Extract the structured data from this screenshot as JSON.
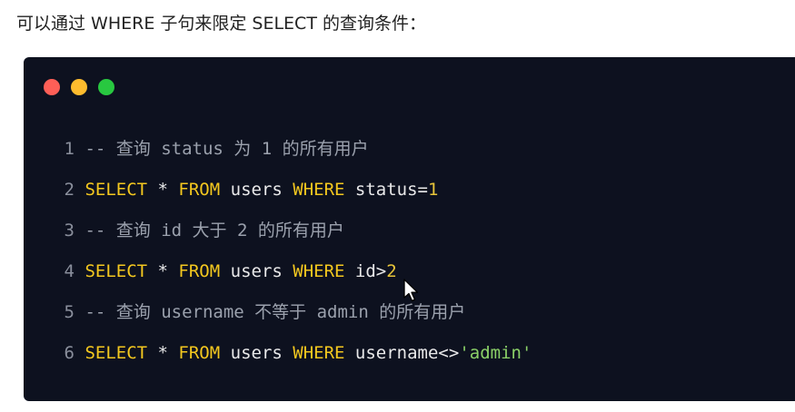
{
  "intro_text": "可以通过 WHERE 子句来限定 SELECT 的查询条件：",
  "window_controls": [
    {
      "name": "close",
      "color": "#fe5f57"
    },
    {
      "name": "minimize",
      "color": "#febc2e"
    },
    {
      "name": "maximize",
      "color": "#28c840"
    }
  ],
  "colors": {
    "card_background": "#0d111f",
    "keyword": "#f4c81f",
    "comment": "#9ba1ad",
    "identifier": "#e9e9ea",
    "number": "#e8c53a",
    "string": "#8bd168"
  },
  "code": {
    "lines": [
      {
        "number": "1",
        "tokens": [
          {
            "type": "comment",
            "text": "-- 查询 status 为 1 的所有用户"
          }
        ]
      },
      {
        "number": "2",
        "tokens": [
          {
            "type": "kw",
            "text": "SELECT"
          },
          {
            "type": "plain",
            "text": " * "
          },
          {
            "type": "kw",
            "text": "FROM"
          },
          {
            "type": "plain",
            "text": " users "
          },
          {
            "type": "kw",
            "text": "WHERE"
          },
          {
            "type": "plain",
            "text": " status="
          },
          {
            "type": "num",
            "text": "1"
          }
        ]
      },
      {
        "number": "3",
        "tokens": [
          {
            "type": "comment",
            "text": "-- 查询 id 大于 2 的所有用户"
          }
        ]
      },
      {
        "number": "4",
        "tokens": [
          {
            "type": "kw",
            "text": "SELECT"
          },
          {
            "type": "plain",
            "text": " * "
          },
          {
            "type": "kw",
            "text": "FROM"
          },
          {
            "type": "plain",
            "text": " users "
          },
          {
            "type": "kw",
            "text": "WHERE"
          },
          {
            "type": "plain",
            "text": " id>"
          },
          {
            "type": "num",
            "text": "2"
          }
        ]
      },
      {
        "number": "5",
        "tokens": [
          {
            "type": "comment",
            "text": "-- 查询 username 不等于 admin 的所有用户"
          }
        ]
      },
      {
        "number": "6",
        "tokens": [
          {
            "type": "kw",
            "text": "SELECT"
          },
          {
            "type": "plain",
            "text": " * "
          },
          {
            "type": "kw",
            "text": "FROM"
          },
          {
            "type": "plain",
            "text": " users "
          },
          {
            "type": "kw",
            "text": "WHERE"
          },
          {
            "type": "plain",
            "text": " username<>"
          },
          {
            "type": "str",
            "text": "'admin'"
          }
        ]
      }
    ]
  }
}
